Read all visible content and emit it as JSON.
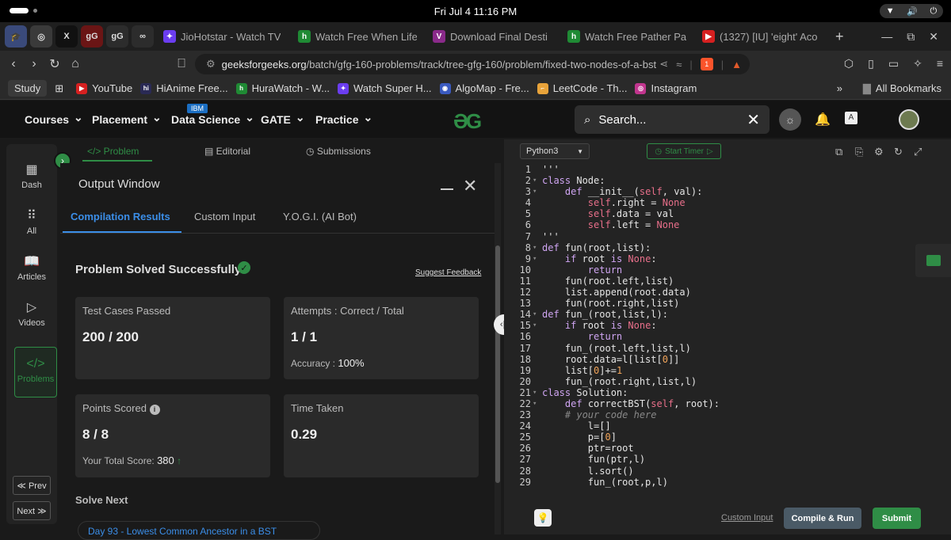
{
  "os": {
    "clock": "Fri Jul 4  11:16 PM",
    "wifi_icon": "wifi-icon",
    "volume_icon": "volume-icon",
    "power_icon": "power-icon"
  },
  "tabs": {
    "pinned": [
      {
        "icon": "graduation-cap-icon",
        "glyph": "🎓",
        "color": "#3a4a7a"
      },
      {
        "icon": "chrome-icon",
        "glyph": "◎",
        "color": "#3a3a3a"
      },
      {
        "icon": "x-icon",
        "glyph": "X",
        "color": "#111"
      },
      {
        "icon": "gfg-icon",
        "glyph": "gG",
        "color": "#6a1515"
      },
      {
        "icon": "gfg-icon",
        "glyph": "gG",
        "color": "#2c2c2c"
      },
      {
        "icon": "algo-icon",
        "glyph": "∞",
        "color": "#2c2c2c"
      }
    ],
    "items": [
      {
        "title": "JioHotstar - Watch TV",
        "color": "#6b3df0",
        "glyph": "✦"
      },
      {
        "title": "Watch Free When Life",
        "color": "#1f8a34",
        "glyph": "h"
      },
      {
        "title": "Download Final Desti",
        "color": "#8a2a8a",
        "glyph": "V"
      },
      {
        "title": "Watch Free Pather Pa",
        "color": "#1f8a34",
        "glyph": "h"
      },
      {
        "title": "(1327) [IU] 'eight' Aco",
        "color": "#d62020",
        "glyph": "▶"
      }
    ],
    "new_tab": "+",
    "controls": [
      "—",
      "⧉",
      "✕"
    ]
  },
  "address": {
    "url_domain": "geeksforgeeks.org",
    "url_path": "/batch/gfg-160-problems/track/tree-gfg-160/problem/fixed-two-nodes-of-a-bst",
    "brave_badge": "1"
  },
  "bookmarks": {
    "study_label": "Study",
    "items": [
      {
        "label": "YouTube",
        "color": "#d62020",
        "glyph": "▶"
      },
      {
        "label": "HiAnime Free...",
        "color": "#2a2a55",
        "glyph": "hi"
      },
      {
        "label": "HuraWatch - W...",
        "color": "#1f8a34",
        "glyph": "h"
      },
      {
        "label": "Watch Super H...",
        "color": "#6b3df0",
        "glyph": "✦"
      },
      {
        "label": "AlgoMap - Fre...",
        "color": "#3a5ac0",
        "glyph": "◉"
      },
      {
        "label": "LeetCode - Th...",
        "color": "#e8a33a",
        "glyph": "⌐"
      },
      {
        "label": "Instagram",
        "color": "#c1358e",
        "glyph": "◎"
      }
    ],
    "more": "»",
    "all_bookmarks": "All Bookmarks"
  },
  "site_nav": {
    "menus": [
      "Courses",
      "Placement",
      "Data Science",
      "GATE",
      "Practice"
    ],
    "ibm_badge": "IBM",
    "logo": "ƏG",
    "search_placeholder": "Search..."
  },
  "rail": {
    "items": [
      {
        "label": "Dash",
        "glyph": "▦"
      },
      {
        "label": "All",
        "glyph": "⠿"
      },
      {
        "label": "Articles",
        "glyph": "📖"
      },
      {
        "label": "Videos",
        "glyph": "▷"
      },
      {
        "label": "Problems",
        "glyph": "</>"
      }
    ],
    "prev": "≪ Prev",
    "next": "Next ≫"
  },
  "problem_tabs": [
    {
      "label": "</> Problem",
      "active": true
    },
    {
      "label": "Editorial",
      "active": false
    },
    {
      "label": "Submissions",
      "active": false
    }
  ],
  "output": {
    "title": "Output Window",
    "tabs": [
      "Compilation Results",
      "Custom Input",
      "Y.O.G.I. (AI Bot)"
    ],
    "status": "Problem Solved Successfully",
    "feedback": "Suggest Feedback",
    "cards": {
      "tests": {
        "label": "Test Cases Passed",
        "value": "200 / 200"
      },
      "attempts": {
        "label": "Attempts : Correct / Total",
        "value": "1 / 1",
        "sub_label": "Accuracy :",
        "sub_value": "100%"
      },
      "points": {
        "label": "Points Scored",
        "value": "8 / 8",
        "sub_label": "Your Total Score:",
        "sub_value": "380"
      },
      "time": {
        "label": "Time Taken",
        "value": "0.29"
      }
    },
    "solve_next": "Solve Next",
    "next_problem": "Day 93 - Lowest Common Ancestor in a BST"
  },
  "editor": {
    "language": "Python3",
    "timer": "Start Timer",
    "custom_input": "Custom Input",
    "compile_run": "Compile & Run",
    "submit": "Submit",
    "lines": [
      {
        "n": "1",
        "fold": "",
        "code": "'''"
      },
      {
        "n": "2",
        "fold": "▾",
        "code": "class Node:"
      },
      {
        "n": "3",
        "fold": "▾",
        "code": "    def __init__(self, val):"
      },
      {
        "n": "4",
        "fold": "",
        "code": "        self.right = None"
      },
      {
        "n": "5",
        "fold": "",
        "code": "        self.data = val"
      },
      {
        "n": "6",
        "fold": "",
        "code": "        self.left = None"
      },
      {
        "n": "7",
        "fold": "",
        "code": "'''"
      },
      {
        "n": "8",
        "fold": "▾",
        "code": "def fun(root,list):"
      },
      {
        "n": "9",
        "fold": "▾",
        "code": "    if root is None:"
      },
      {
        "n": "10",
        "fold": "",
        "code": "        return"
      },
      {
        "n": "11",
        "fold": "",
        "code": "    fun(root.left,list)"
      },
      {
        "n": "12",
        "fold": "",
        "code": "    list.append(root.data)"
      },
      {
        "n": "13",
        "fold": "",
        "code": "    fun(root.right,list)"
      },
      {
        "n": "14",
        "fold": "▾",
        "code": "def fun_(root,list,l):"
      },
      {
        "n": "15",
        "fold": "▾",
        "code": "    if root is None:"
      },
      {
        "n": "16",
        "fold": "",
        "code": "        return"
      },
      {
        "n": "17",
        "fold": "",
        "code": "    fun_(root.left,list,l)"
      },
      {
        "n": "18",
        "fold": "",
        "code": "    root.data=l[list[0]]"
      },
      {
        "n": "19",
        "fold": "",
        "code": "    list[0]+=1"
      },
      {
        "n": "20",
        "fold": "",
        "code": "    fun_(root.right,list,l)"
      },
      {
        "n": "21",
        "fold": "▾",
        "code": "class Solution:"
      },
      {
        "n": "22",
        "fold": "▾",
        "code": "    def correctBST(self, root):"
      },
      {
        "n": "23",
        "fold": "",
        "code": "    # your code here"
      },
      {
        "n": "24",
        "fold": "",
        "code": "        l=[]"
      },
      {
        "n": "25",
        "fold": "",
        "code": "        p=[0]"
      },
      {
        "n": "26",
        "fold": "",
        "code": "        ptr=root"
      },
      {
        "n": "27",
        "fold": "",
        "code": "        fun(ptr,l)"
      },
      {
        "n": "28",
        "fold": "",
        "code": "        l.sort()"
      },
      {
        "n": "29",
        "fold": "",
        "code": "        fun_(root,p,l)"
      }
    ]
  },
  "colors": {
    "accent": "#2f8d46",
    "link": "#3b8ee8"
  }
}
